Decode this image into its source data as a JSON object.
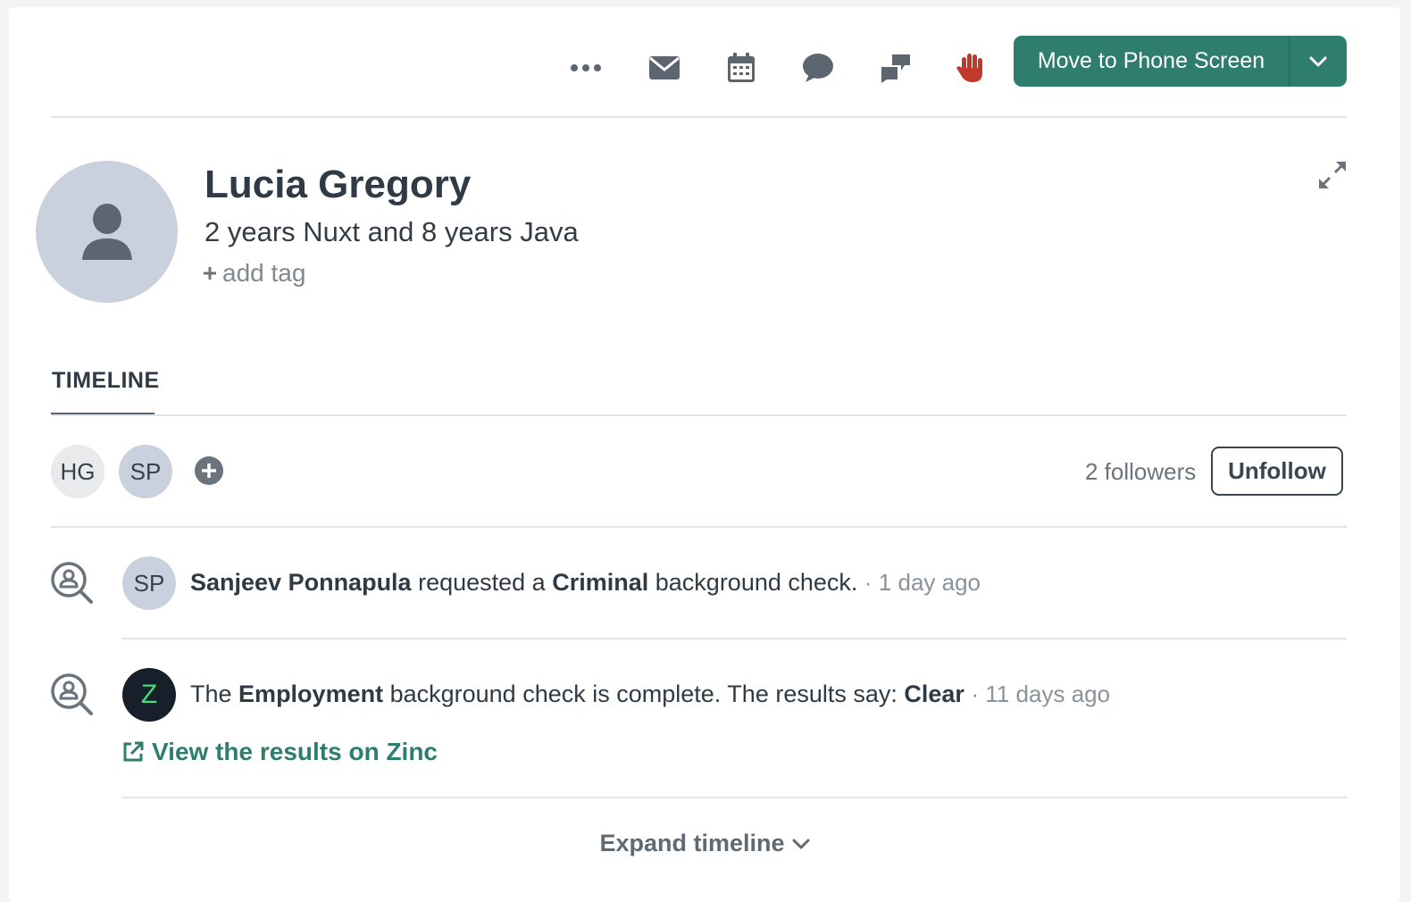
{
  "toolbar": {
    "icons": [
      "more-icon",
      "mail-icon",
      "calendar-icon",
      "chat-icon",
      "feedback-icon",
      "hand-stop-icon"
    ],
    "primary_action": "Move to Phone Screen"
  },
  "candidate": {
    "name": "Lucia Gregory",
    "headline": "2 years Nuxt and 8 years Java",
    "add_tag": "add tag"
  },
  "tabs": [
    {
      "label": "TIMELINE",
      "active": true
    }
  ],
  "followers": {
    "avatars": [
      {
        "initials": "HG",
        "color": "#e8eaec"
      },
      {
        "initials": "SP",
        "color": "#c8d1dd"
      }
    ],
    "count_text": "2 followers",
    "unfollow_label": "Unfollow"
  },
  "timeline": [
    {
      "avatar": "SP",
      "actor": "Sanjeev Ponnapula",
      "text_1": "requested a",
      "check_type": "Criminal",
      "text_2": "background check.",
      "time": "· 1 day ago"
    },
    {
      "avatar": "Z",
      "text_1": "The",
      "check_type": "Employment",
      "text_2": "background check is complete. The results say:",
      "result": "Clear",
      "time": "· 11 days ago",
      "link_label": "View the results on Zinc"
    }
  ],
  "expand_timeline": "Expand timeline",
  "colors": {
    "primary": "#2e7d6e",
    "hand_icon": "#c0392b",
    "zinc_avatar_bg": "#17202a",
    "zinc_avatar_fg": "#4cd97b"
  }
}
